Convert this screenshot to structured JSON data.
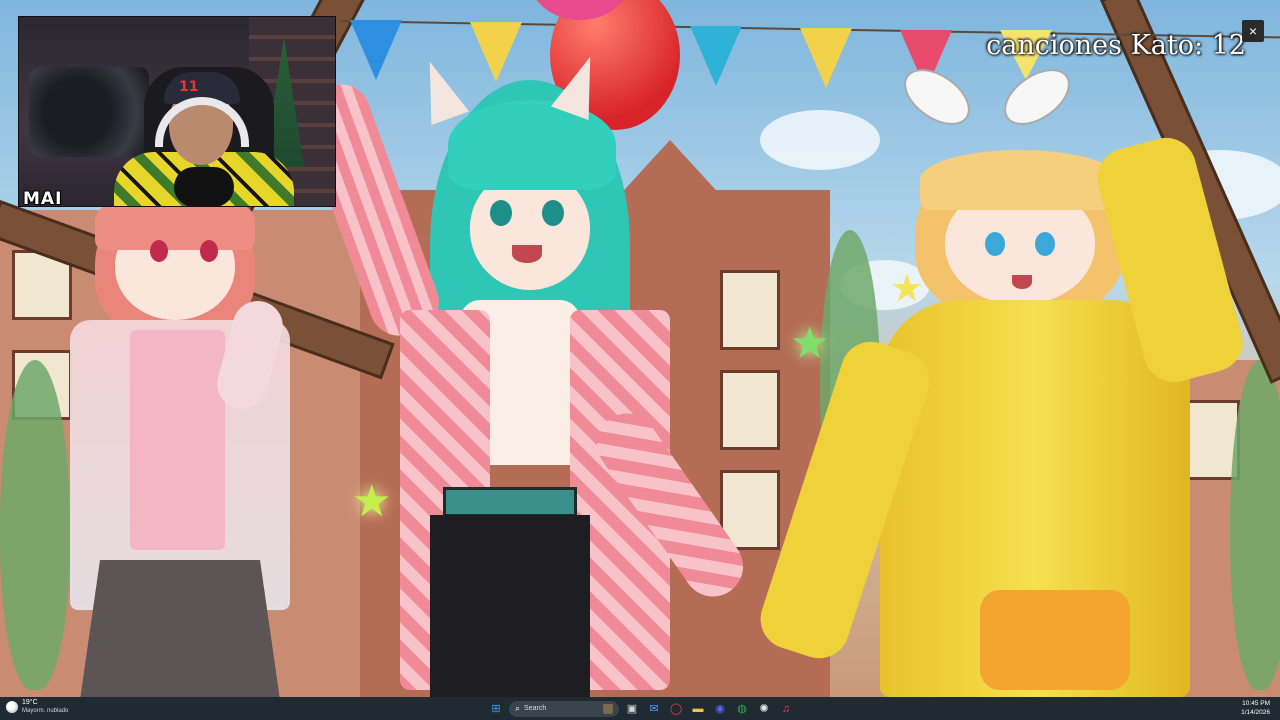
{
  "overlay": {
    "counter_text": "canciones Kato: 12",
    "close_symbol": "×"
  },
  "webcam": {
    "label": "MAI",
    "cap_logo": "11"
  },
  "taskbar": {
    "weather": {
      "temperature": "19°C",
      "description": "Mayorm. nublado",
      "icon": "cloud-icon"
    },
    "search": {
      "placeholder": "Search"
    },
    "apps": [
      {
        "name": "windows-start-icon",
        "glyph": "⊞",
        "color": "#3aa0ff"
      },
      {
        "name": "task-view-icon",
        "glyph": "▣",
        "color": "#cfd6dc"
      },
      {
        "name": "mail-icon",
        "glyph": "✉",
        "color": "#4aa3ff"
      },
      {
        "name": "opera-icon",
        "glyph": "◯",
        "color": "#ff3b3b"
      },
      {
        "name": "file-explorer-icon",
        "glyph": "▬",
        "color": "#f4c542"
      },
      {
        "name": "discord-icon",
        "glyph": "◉",
        "color": "#5865f2"
      },
      {
        "name": "chrome-icon",
        "glyph": "◍",
        "color": "#34a853"
      },
      {
        "name": "chatgpt-icon",
        "glyph": "✺",
        "color": "#e8e8e8"
      },
      {
        "name": "apple-music-icon",
        "glyph": "♫",
        "color": "#fa3c5a"
      }
    ],
    "clock": {
      "time": "10:45 PM",
      "date": "1/14/2026"
    }
  },
  "colors": {
    "taskbar_bg": "#202a33",
    "hoodie_yellow": "#f2d43a",
    "teal_hair": "#2fc6b6",
    "pink_hair": "#e9857a",
    "blonde_hair": "#f3c26a"
  }
}
